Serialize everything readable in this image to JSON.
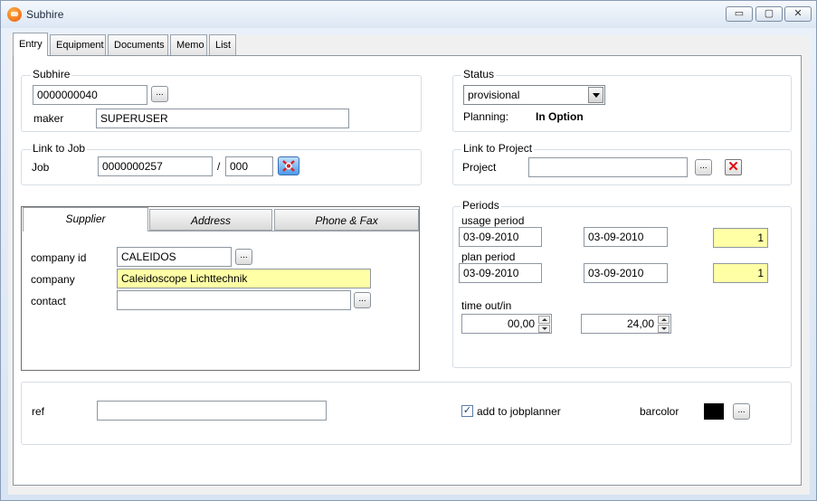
{
  "window": {
    "title": "Subhire",
    "controls": [
      "▭",
      "▢",
      "✕"
    ]
  },
  "tabs": [
    "Entry",
    "Equipment",
    "Documents",
    "Memo",
    "List"
  ],
  "subhire": {
    "legend": "Subhire",
    "number": "0000000040",
    "dots": "...",
    "maker_label": "maker",
    "maker_value": "SUPERUSER"
  },
  "status": {
    "legend": "Status",
    "selected": "provisional",
    "planning_label": "Planning:",
    "planning_value": "In Option"
  },
  "link_job": {
    "legend": "Link to Job",
    "job_label": "Job",
    "job_number": "0000000257",
    "separator": "/",
    "job_sub": "000"
  },
  "link_project": {
    "legend": "Link to Project",
    "project_label": "Project",
    "project_value": "",
    "dots": "...",
    "delete_glyph": "✕"
  },
  "supplier": {
    "tabs": [
      "Supplier",
      "Address",
      "Phone & Fax"
    ],
    "company_id_label": "company id",
    "company_id": "CALEIDOS",
    "company_label": "company",
    "company": "Caleidoscope Lichttechnik",
    "contact_label": "contact",
    "contact": "",
    "dots": "..."
  },
  "periods": {
    "legend": "Periods",
    "usage_label": "usage period",
    "usage_from": "03-09-2010",
    "usage_to": "03-09-2010",
    "usage_days": "1",
    "plan_label": "plan period",
    "plan_from": "03-09-2010",
    "plan_to": "03-09-2010",
    "plan_days": "1",
    "time_label": "time out/in",
    "time_out": "00,00",
    "time_in": "24,00"
  },
  "bottom": {
    "ref_label": "ref",
    "ref_value": "",
    "jobplanner_label": "add to jobplanner",
    "jobplanner_checked": "✓",
    "barcolor_label": "barcolor",
    "barcolor": "#000000",
    "dots": "..."
  }
}
